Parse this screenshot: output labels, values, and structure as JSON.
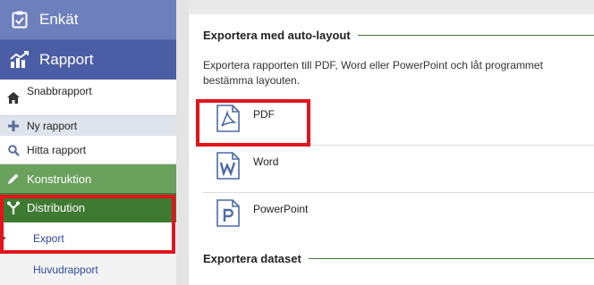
{
  "sidebar": {
    "enkat": {
      "label": "Enkät",
      "icon": "clipboard-check-icon"
    },
    "rapport": {
      "label": "Rapport",
      "icon": "bar-chart-icon"
    },
    "snabbrapport": {
      "label": "Snabbrapport",
      "icon": "home-icon"
    },
    "ny_rapport": {
      "label": "Ny rapport",
      "icon": "plus-icon"
    },
    "hitta_rapport": {
      "label": "Hitta rapport",
      "icon": "search-icon"
    },
    "konstruktion": {
      "label": "Konstruktion",
      "icon": "pencil-icon"
    },
    "distribution": {
      "label": "Distribution",
      "icon": "fork-icon"
    },
    "export": {
      "label": "Export"
    },
    "huvudrapport": {
      "label": "Huvudrapport"
    }
  },
  "content": {
    "auto_layout_heading": "Exportera med auto-layout",
    "auto_layout_desc": "Exportera rapporten till PDF, Word eller PowerPoint och låt programmet bestämma layouten.",
    "exports": [
      {
        "label": "PDF",
        "icon": "pdf-file-icon"
      },
      {
        "label": "Word",
        "icon": "word-file-icon"
      },
      {
        "label": "PowerPoint",
        "icon": "powerpoint-file-icon"
      }
    ],
    "dataset_heading": "Exportera dataset"
  },
  "colors": {
    "enkat_bg": "#6d7fbc",
    "rapport_bg": "#4a5da5",
    "konstruktion_bg": "#6aa15d",
    "distribution_bg": "#3e7a32",
    "highlight": "#e3141c",
    "link": "#2a4a9a"
  }
}
